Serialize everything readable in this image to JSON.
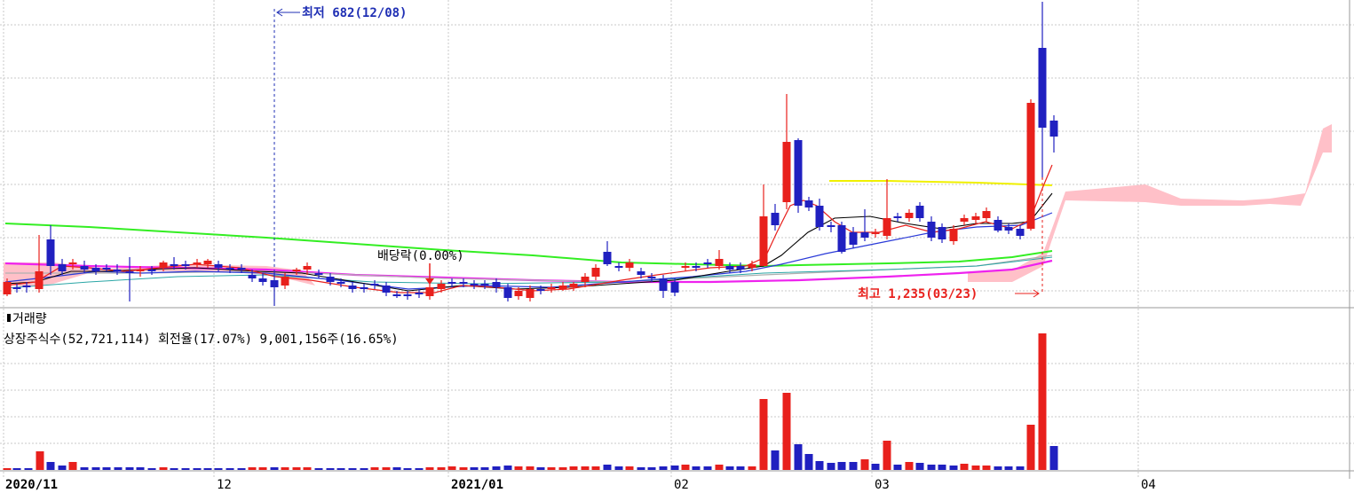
{
  "chart_data": {
    "type": "candlestick",
    "price_annotations": {
      "low_label": "최저 682(12/08)",
      "high_label": "최고 1,235(03/23)",
      "dividend_label": "배당락(0.00%)"
    },
    "volume_panel": {
      "title": "거래량",
      "info": "상장주식수(52,721,114) 회전율(17.07%) 9,001,156주(16.65%)"
    },
    "x_labels": [
      {
        "label": "2020/11",
        "bold": true
      },
      {
        "label": "12",
        "bold": false
      },
      {
        "label": "2021/01",
        "bold": true
      },
      {
        "label": "02",
        "bold": false
      },
      {
        "label": "03",
        "bold": false
      },
      {
        "label": "04",
        "bold": false
      }
    ],
    "colors": {
      "up": "#e8201c",
      "down": "#2020c0",
      "ma_green": "#33ee22",
      "ma_magenta": "#ee22ee",
      "ma_yellow": "#f0f000",
      "cloud": "#ffc0c8",
      "annotation_blue": "#1f2fb4",
      "annotation_red": "#e8201c"
    }
  }
}
